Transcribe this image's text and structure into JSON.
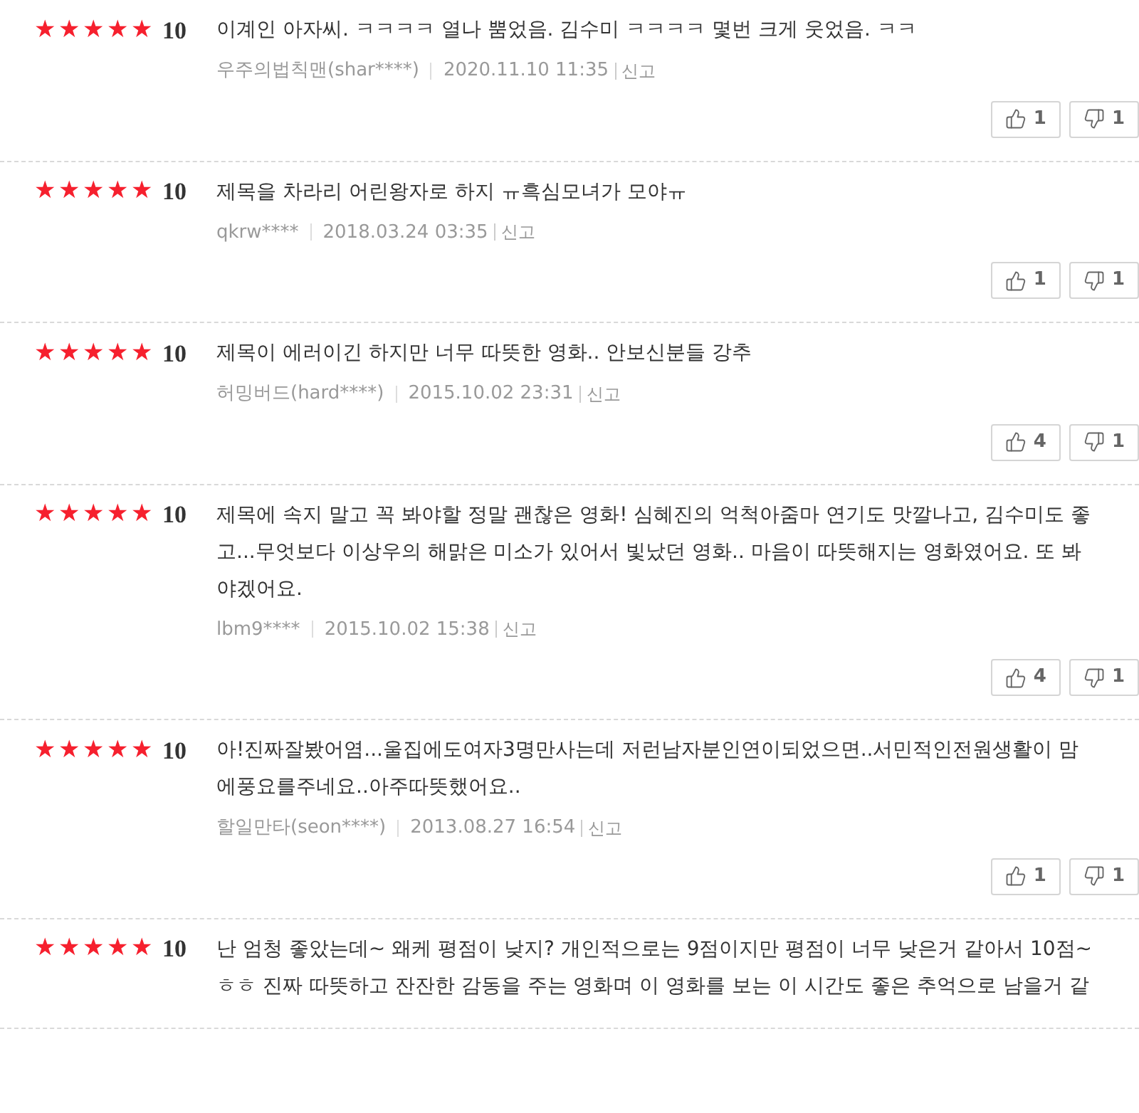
{
  "reviews": [
    {
      "stars": 5,
      "score": "10",
      "text_lines": [
        "이계인 아자씨. ㅋㅋㅋㅋ 열나 뿜었음. 김수미 ㅋㅋㅋㅋ 몇번 크게 웃었음. ㅋㅋ"
      ],
      "author": "우주의법칙맨(shar****)",
      "date": "2020.11.10 11:35",
      "report": "신고",
      "likes": "1",
      "dislikes": "1"
    },
    {
      "stars": 5,
      "score": "10",
      "text_lines": [
        "제목을 차라리 어린왕자로 하지 ㅠ흑심모녀가 모야ㅠ"
      ],
      "author": "qkrw****",
      "date": "2018.03.24 03:35",
      "report": "신고",
      "likes": "1",
      "dislikes": "1"
    },
    {
      "stars": 5,
      "score": "10",
      "text_lines": [
        "제목이 에러이긴 하지만 너무 따뜻한 영화.. 안보신분들 강추"
      ],
      "author": "허밍버드(hard****)",
      "date": "2015.10.02 23:31",
      "report": "신고",
      "likes": "4",
      "dislikes": "1"
    },
    {
      "stars": 5,
      "score": "10",
      "text_lines": [
        "제목에 속지 말고 꼭 봐야할 정말 괜찮은 영화! 심혜진의 억척아줌마 연기도 맛깔나고, 김수미도 좋",
        "고...무엇보다 이상우의 해맑은 미소가 있어서 빛났던 영화.. 마음이 따뜻해지는 영화였어요. 또 봐",
        "야겠어요."
      ],
      "author": "lbm9****",
      "date": "2015.10.02 15:38",
      "report": "신고",
      "likes": "4",
      "dislikes": "1"
    },
    {
      "stars": 5,
      "score": "10",
      "text_lines": [
        "아!진짜잘봤어염...울집에도여자3명만사는데 저런남자분인연이되었으면..서민적인전원생활이 맘",
        "에풍요를주네요..아주따뜻했어요.."
      ],
      "author": "할일만타(seon****)",
      "date": "2013.08.27 16:54",
      "report": "신고",
      "likes": "1",
      "dislikes": "1"
    },
    {
      "stars": 5,
      "score": "10",
      "text_lines": [
        "난 엄청 좋았는데~ 왜케 평점이 낮지? 개인적으로는 9점이지만 평점이 너무 낮은거 같아서 10점~",
        "ㅎㅎ 진짜 따뜻하고 잔잔한 감동을 주는 영화며 이 영화를 보는 이 시간도 좋은 추억으로 남을거 같"
      ]
    }
  ]
}
